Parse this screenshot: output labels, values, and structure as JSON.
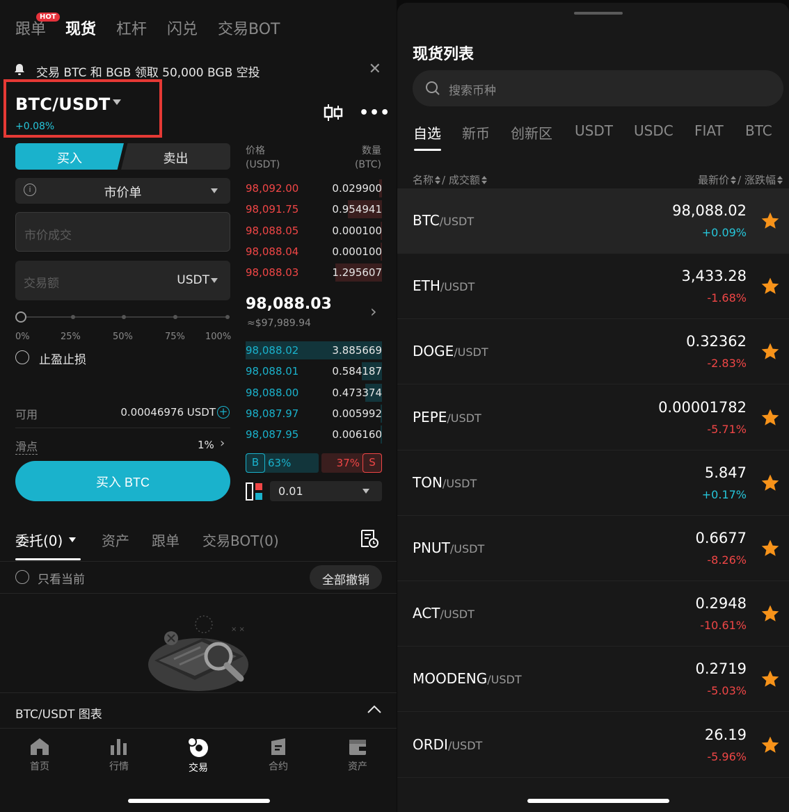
{
  "left": {
    "top_tabs": [
      {
        "label": "跟单",
        "hot": "HOT"
      },
      {
        "label": "现货",
        "active": true
      },
      {
        "label": "杠杆"
      },
      {
        "label": "闪兑"
      },
      {
        "label": "交易BOT"
      }
    ],
    "announcement": "交易 BTC 和 BGB 领取 50,000 BGB 空投",
    "pair": "BTC/USDT",
    "pair_change": "+0.08%",
    "buy_tab": "买入",
    "sell_tab": "卖出",
    "order_type": "市价单",
    "price_placeholder": "市价成交",
    "amount_placeholder": "交易额",
    "amount_unit": "USDT",
    "slider_percents": [
      "0%",
      "25%",
      "50%",
      "75%",
      "100%"
    ],
    "slider_value": 0,
    "tpsl_label": "止盈止损",
    "available_label": "可用",
    "available_value": "0.00046976 USDT",
    "slippage_label": "滑点",
    "slippage_value": "1%",
    "buy_button": "买入 BTC",
    "orderbook": {
      "price_header": "价格",
      "price_unit": "(USDT)",
      "qty_header": "数量",
      "qty_unit": "(BTC)",
      "asks": [
        {
          "price": "98,092.00",
          "qty": "0.029900",
          "depth": 0.02
        },
        {
          "price": "98,091.75",
          "qty": "0.954941",
          "depth": 0.25
        },
        {
          "price": "98,088.05",
          "qty": "0.000100",
          "depth": 0.01
        },
        {
          "price": "98,088.04",
          "qty": "0.000100",
          "depth": 0.01
        },
        {
          "price": "98,088.03",
          "qty": "1.295607",
          "depth": 0.34
        }
      ],
      "last_price": "98,088.03",
      "last_price_usd": "≈$97,989.94",
      "bids": [
        {
          "price": "98,088.02",
          "qty": "3.885669",
          "depth": 1.0
        },
        {
          "price": "98,088.01",
          "qty": "0.584187",
          "depth": 0.15
        },
        {
          "price": "98,088.00",
          "qty": "0.473374",
          "depth": 0.12
        },
        {
          "price": "98,087.97",
          "qty": "0.005992",
          "depth": 0.01
        },
        {
          "price": "98,087.95",
          "qty": "0.006160",
          "depth": 0.01
        }
      ],
      "buy_ratio_tag": "B",
      "buy_ratio": "63%",
      "sell_ratio": "37%",
      "sell_ratio_tag": "S",
      "precision": "0.01"
    },
    "order_tabs": [
      "委托(0)",
      "资产",
      "跟单",
      "交易BOT(0)"
    ],
    "only_current": "只看当前",
    "cancel_all": "全部撤销",
    "chart_bar": "BTC/USDT 图表",
    "nav": [
      "首页",
      "行情",
      "交易",
      "合约",
      "资产"
    ]
  },
  "right": {
    "title": "现货列表",
    "search_placeholder": "搜索币种",
    "tabs": [
      "自选",
      "新币",
      "创新区",
      "USDT",
      "USDC",
      "FIAT",
      "BTC"
    ],
    "col_name": "名称",
    "col_volume": "/ 成交额",
    "col_price": "最新价",
    "col_change": "/ 涨跌幅",
    "coins": [
      {
        "base": "BTC",
        "quote": "/USDT",
        "price": "98,088.02",
        "change": "+0.09%",
        "dir": "up"
      },
      {
        "base": "ETH",
        "quote": "/USDT",
        "price": "3,433.28",
        "change": "-1.68%",
        "dir": "down"
      },
      {
        "base": "DOGE",
        "quote": "/USDT",
        "price": "0.32362",
        "change": "-2.83%",
        "dir": "down"
      },
      {
        "base": "PEPE",
        "quote": "/USDT",
        "price": "0.00001782",
        "change": "-5.71%",
        "dir": "down"
      },
      {
        "base": "TON",
        "quote": "/USDT",
        "price": "5.847",
        "change": "+0.17%",
        "dir": "up"
      },
      {
        "base": "PNUT",
        "quote": "/USDT",
        "price": "0.6677",
        "change": "-8.26%",
        "dir": "down"
      },
      {
        "base": "ACT",
        "quote": "/USDT",
        "price": "0.2948",
        "change": "-10.61%",
        "dir": "down"
      },
      {
        "base": "MOODENG",
        "quote": "/USDT",
        "price": "0.2719",
        "change": "-5.03%",
        "dir": "down"
      },
      {
        "base": "ORDI",
        "quote": "/USDT",
        "price": "26.19",
        "change": "-5.96%",
        "dir": "down"
      }
    ]
  },
  "colors": {
    "accent": "#1ab2cc",
    "sell": "#f04646",
    "star": "#f7931a",
    "highlight_box": "#e53935"
  }
}
